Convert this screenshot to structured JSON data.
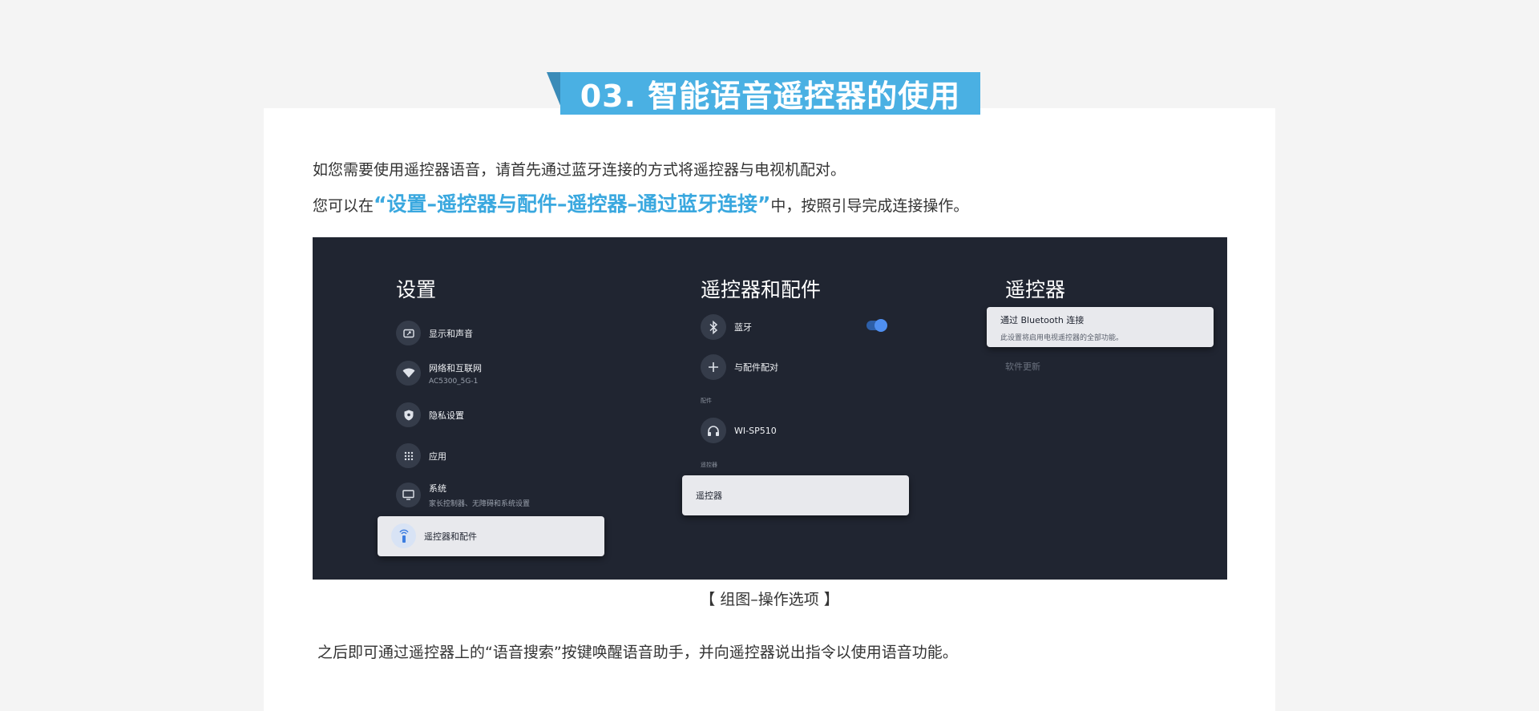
{
  "banner": {
    "title": "03. 智能语音遥控器的使用"
  },
  "intro": {
    "line1": "如您需要使用遥控器语音，请首先通过蓝牙连接的方式将遥控器与电视机配对。",
    "line2_prefix": "您可以在",
    "line2_highlight": "“设置–遥控器与配件–遥控器–通过蓝牙连接”",
    "line2_suffix": "中，按照引导完成连接操作。"
  },
  "screen": {
    "settings": {
      "title": "设置",
      "items": [
        {
          "label": "显示和声音",
          "sub": "",
          "icon": "display-sound-icon"
        },
        {
          "label": "网络和互联网",
          "sub": "AC5300_5G-1",
          "icon": "wifi-icon"
        },
        {
          "label": "隐私设置",
          "sub": "",
          "icon": "privacy-shield-icon"
        },
        {
          "label": "应用",
          "sub": "",
          "icon": "apps-grid-icon"
        },
        {
          "label": "系统",
          "sub": "家长控制器、无障碍和系统设置",
          "icon": "tv-system-icon"
        },
        {
          "label": "遥控器和配件",
          "sub": "",
          "icon": "remote-icon"
        }
      ]
    },
    "remotes": {
      "title": "遥控器和配件",
      "bluetooth_label": "蓝牙",
      "bluetooth_on": true,
      "pair_label": "与配件配对",
      "accessories_header": "配件",
      "accessory_label": "WI-SP510",
      "remote_header": "遥控器",
      "remote_item_label": "遥控器"
    },
    "remote": {
      "title": "遥控器",
      "connect_label": "通过 Bluetooth 连接",
      "connect_sub": "此设置将启用电视遥控器的全部功能。",
      "update_label": "软件更新"
    },
    "colors": {
      "screen_bg": "#202531",
      "accent": "#4ab0e3",
      "toggle": "#4f8ff0"
    }
  },
  "caption": "【 组图–操作选项 】",
  "outro": "之后即可通过遥控器上的“语音搜索”按键唤醒语音助手，并向遥控器说出指令以使用语音功能。"
}
